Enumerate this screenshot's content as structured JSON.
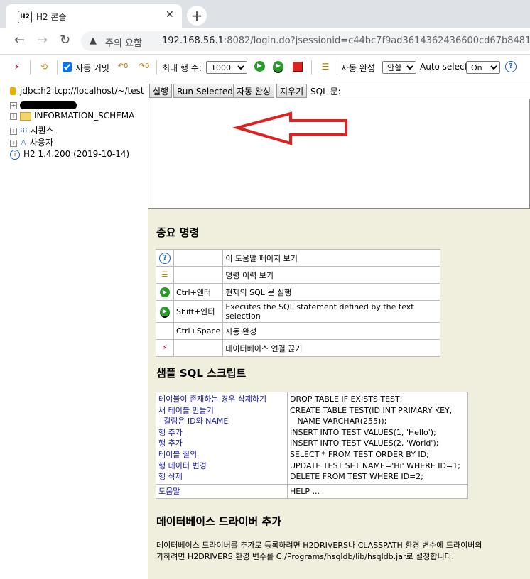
{
  "browser": {
    "tab_title": "H2 콘솔",
    "tab_favicon": "H2",
    "warning_text": "주의 요함",
    "url_host": "192.168.56.1",
    "url_rest": ":8082/login.do?jsessionid=c44bc7f9ad3614362436600cd67b8481"
  },
  "toolbar": {
    "auto_commit_label": "자동 커밋",
    "auto_commit_checked": true,
    "max_rows_label": "최대 행 수:",
    "max_rows_value": "1000",
    "auto_complete_label": "자동 완성",
    "auto_complete_value": "안함",
    "auto_select_label": "Auto select",
    "auto_select_value": "On",
    "help_icon": "?"
  },
  "tree": {
    "connection": "jdbc:h2:tcp://localhost/~/test",
    "items": [
      {
        "label": "",
        "icon": "redacted"
      },
      {
        "label": "INFORMATION_SCHEMA",
        "icon": "folder-icon"
      },
      {
        "label": "시퀀스",
        "icon": "sequence-icon"
      },
      {
        "label": "사용자",
        "icon": "users-icon"
      }
    ],
    "version": "H2 1.4.200 (2019-10-14)"
  },
  "query": {
    "run_label": "실행",
    "run_selected_label": "Run Selected",
    "auto_complete_label": "자동 완성",
    "clear_label": "지우기",
    "sql_label": "SQL 문:"
  },
  "help": {
    "important_title": "중요 명령",
    "commands": [
      {
        "icon": "?",
        "key": "",
        "desc": "이 도움말 페이지 보기"
      },
      {
        "icon": "history",
        "key": "",
        "desc": "명령 이력 보기"
      },
      {
        "icon": "run",
        "key": "Ctrl+엔터",
        "desc": "현재의 SQL 문 실행"
      },
      {
        "icon": "run-selected",
        "key": "Shift+엔터",
        "desc": "Executes the SQL statement defined by the text selection"
      },
      {
        "icon": "",
        "key": "Ctrl+Space",
        "desc": "자동 완성"
      },
      {
        "icon": "disconnect",
        "key": "",
        "desc": "데이터베이스 연결 끊기"
      }
    ],
    "sample_title": "샘플 SQL 스크립트",
    "samples": [
      {
        "label": "테이블이 존재하는 경우 삭제하기",
        "sql": "DROP TABLE IF EXISTS TEST;"
      },
      {
        "label": "새 테이블 만들기",
        "sql": "CREATE TABLE TEST(ID INT PRIMARY KEY,"
      },
      {
        "label": "  컬럼은 ID와 NAME",
        "sql": "   NAME VARCHAR(255));"
      },
      {
        "label": "행 추가",
        "sql": "INSERT INTO TEST VALUES(1, 'Hello');"
      },
      {
        "label": "행 추가",
        "sql": "INSERT INTO TEST VALUES(2, 'World');"
      },
      {
        "label": "테이블 질의",
        "sql": "SELECT * FROM TEST ORDER BY ID;"
      },
      {
        "label": "행 데이터 변경",
        "sql": "UPDATE TEST SET NAME='Hi' WHERE ID=1;"
      },
      {
        "label": "행 삭제",
        "sql": "DELETE FROM TEST WHERE ID=2;"
      }
    ],
    "help_row": {
      "label": "도움말",
      "sql": "HELP ..."
    },
    "driver_title": "데이터베이스 드라이버 추가",
    "driver_line1": "데이터베이스 드라이버를 추가로 등록하려면 H2DRIVERS나 CLASSPATH 환경 변수에 드라이버의",
    "driver_line2": "가하려면 H2DRIVERS 환경 변수를 C:/Programs/hsqldb/lib/hsqldb.jar로 설정합니다."
  }
}
